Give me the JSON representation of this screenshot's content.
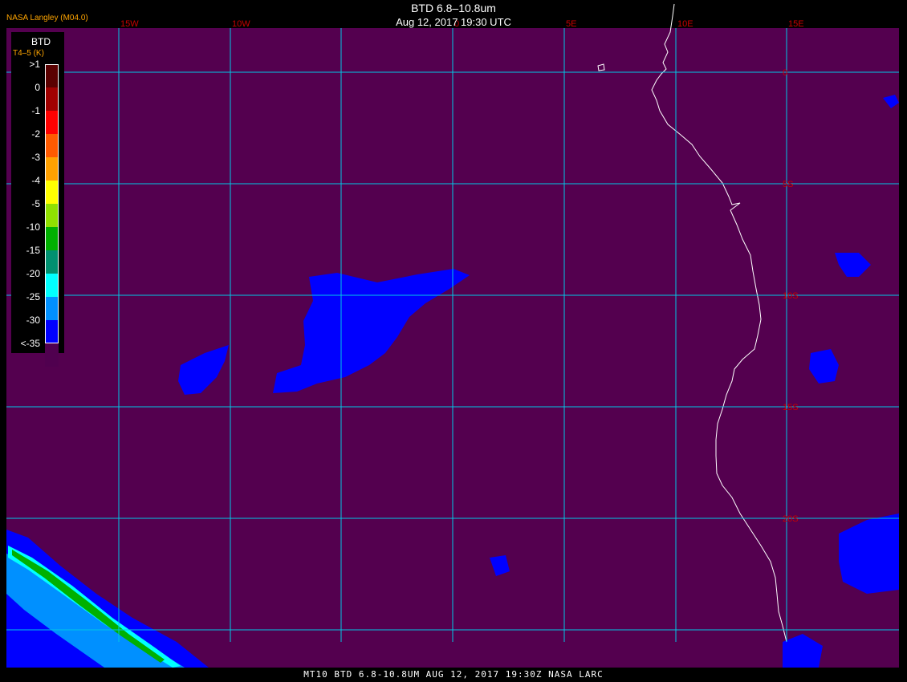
{
  "header": {
    "title": "BTD 6.8–10.8um",
    "subtitle": "Aug 12, 2017 19:30 UTC",
    "producer": "NASA Langley (M04.0)"
  },
  "legend": {
    "title": "BTD",
    "subtitle": "T4–5 (K)",
    "entries": [
      {
        "label": ">1",
        "color": "#5a0000"
      },
      {
        "label": "0",
        "color": "#a00000"
      },
      {
        "label": "-1",
        "color": "#ff0000"
      },
      {
        "label": "-2",
        "color": "#ff5a00"
      },
      {
        "label": "-3",
        "color": "#ffa000"
      },
      {
        "label": "-4",
        "color": "#ffff00"
      },
      {
        "label": "-5",
        "color": "#90e000"
      },
      {
        "label": "-10",
        "color": "#00b000"
      },
      {
        "label": "-15",
        "color": "#009070"
      },
      {
        "label": "-20",
        "color": "#00ffff"
      },
      {
        "label": "-25",
        "color": "#0090ff"
      },
      {
        "label": "-30",
        "color": "#0000ff"
      },
      {
        "label": "<-35",
        "color": "#50004f"
      }
    ]
  },
  "grid": {
    "longitudes": [
      "15W",
      "10W",
      "0",
      "5E",
      "10E",
      "15E"
    ],
    "latitudes": [
      "0",
      "5S",
      "10S",
      "15S",
      "20S"
    ]
  },
  "colors": {
    "background": "#54004f",
    "grid": "#00c8e6",
    "grid_label": "#c80000",
    "coast": "#ffffff"
  },
  "footer": "MT10  BTD 6.8-10.8UM   AUG 12, 2017 19:30Z   NASA LARC"
}
